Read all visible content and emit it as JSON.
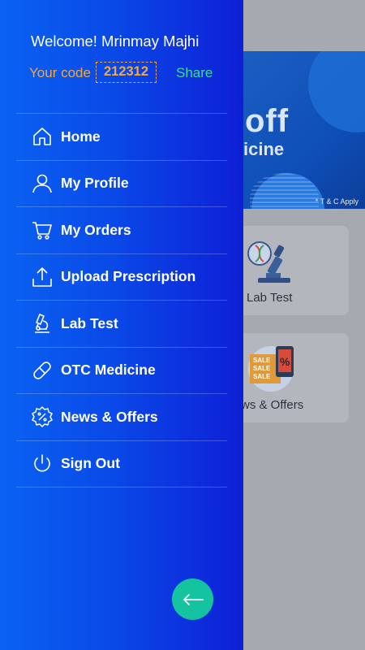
{
  "drawer": {
    "welcome_text": "Welcome! Mrinmay Majhi",
    "code_label": "Your code",
    "code_value": "212312",
    "share_label": "Share",
    "menu": [
      {
        "label": "Home",
        "icon": "home-icon"
      },
      {
        "label": "My Profile",
        "icon": "user-icon"
      },
      {
        "label": "My Orders",
        "icon": "cart-icon"
      },
      {
        "label": "Upload Prescription",
        "icon": "upload-icon"
      },
      {
        "label": "Lab Test",
        "icon": "microscope-icon"
      },
      {
        "label": "OTC Medicine",
        "icon": "pill-icon"
      },
      {
        "label": "News & Offers",
        "icon": "discount-badge-icon"
      },
      {
        "label": "Sign Out",
        "icon": "power-icon"
      }
    ],
    "close_button": {
      "icon": "arrow-left-icon"
    }
  },
  "background": {
    "banner": {
      "big_text": "off",
      "sub_text": "icine",
      "terms": "* T & C Apply"
    },
    "cards": [
      {
        "label": "Lab Test"
      },
      {
        "label": "ws & Offers"
      }
    ],
    "sale_words": [
      "SALE",
      "SALE",
      "SALE"
    ],
    "percent_sign": "%"
  },
  "colors": {
    "drawer_gradient_start": "#0a62f2",
    "drawer_gradient_end": "#0e1fd6",
    "code_accent": "#f2a93b",
    "share_accent": "#36e08a",
    "fab": "#14c4a0"
  }
}
